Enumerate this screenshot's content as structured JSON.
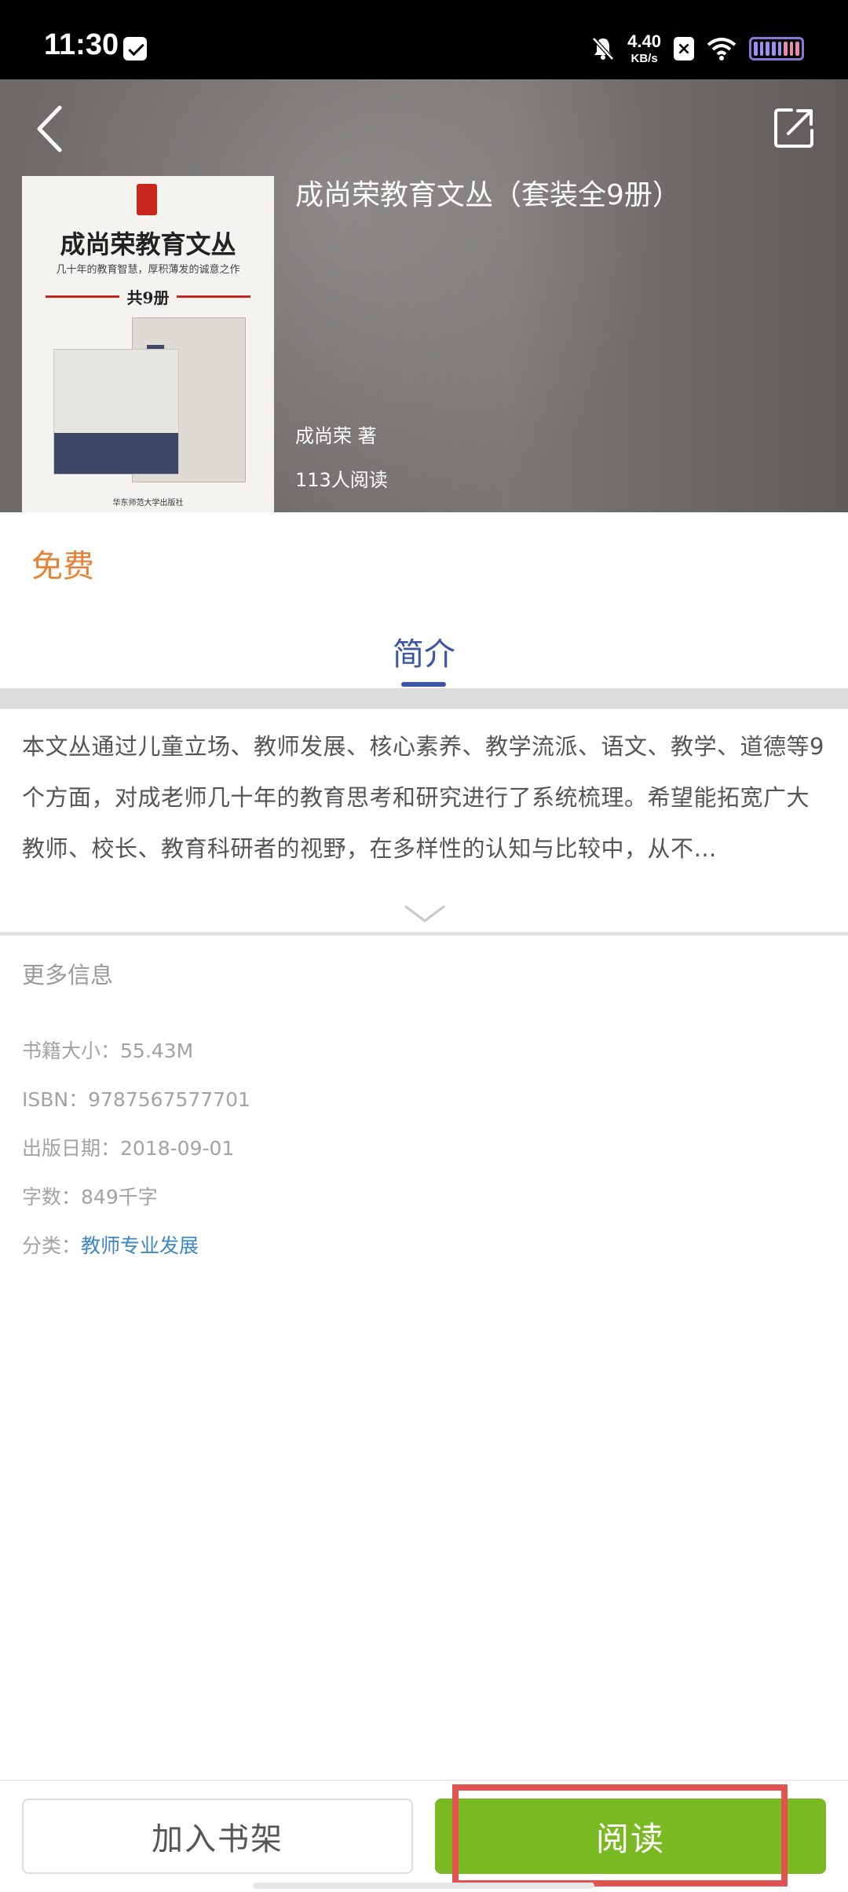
{
  "status_bar": {
    "time": "11:30",
    "net_speed_value": "4.40",
    "net_speed_unit": "KB/s",
    "x_badge": "×"
  },
  "header": {
    "back_icon": "chevron-left-icon",
    "share_icon": "share-external-icon",
    "cover": {
      "title": "成尚荣教育文丛",
      "subtitle": "几十年的教育智慧，厚积薄发的诚意之作",
      "count": "共9册",
      "publisher": "华东师范大学出版社"
    },
    "book_title": "成尚荣教育文丛（套装全9册）",
    "author": "成尚荣 著",
    "readers": "113人阅读"
  },
  "price": "免费",
  "tab": {
    "label": "简介"
  },
  "description": "本文丛通过儿童立场、教师发展、核心素养、教学流派、语文、教学、道德等9个方面，对成老师几十年的教育思考和研究进行了系统梳理。希望能拓宽广大教师、校长、教育科研者的视野，在多样性的认知与比较中，从不…",
  "more_info": {
    "title": "更多信息",
    "size_label": "书籍大小：",
    "size_value": "55.43M",
    "isbn_label": "ISBN：",
    "isbn_value": "9787567577701",
    "date_label": "出版日期：",
    "date_value": "2018-09-01",
    "words_label": "字数：",
    "words_value": "849千字",
    "category_label": "分类：",
    "category_value": "教师专业发展"
  },
  "bottom_bar": {
    "add_shelf_label": "加入书架",
    "read_label": "阅读"
  },
  "colors": {
    "accent_price": "#e58233",
    "tab_blue": "#3d55a6",
    "link_blue": "#3b86c7",
    "read_green": "#79b921",
    "highlight_red": "#e35350"
  }
}
